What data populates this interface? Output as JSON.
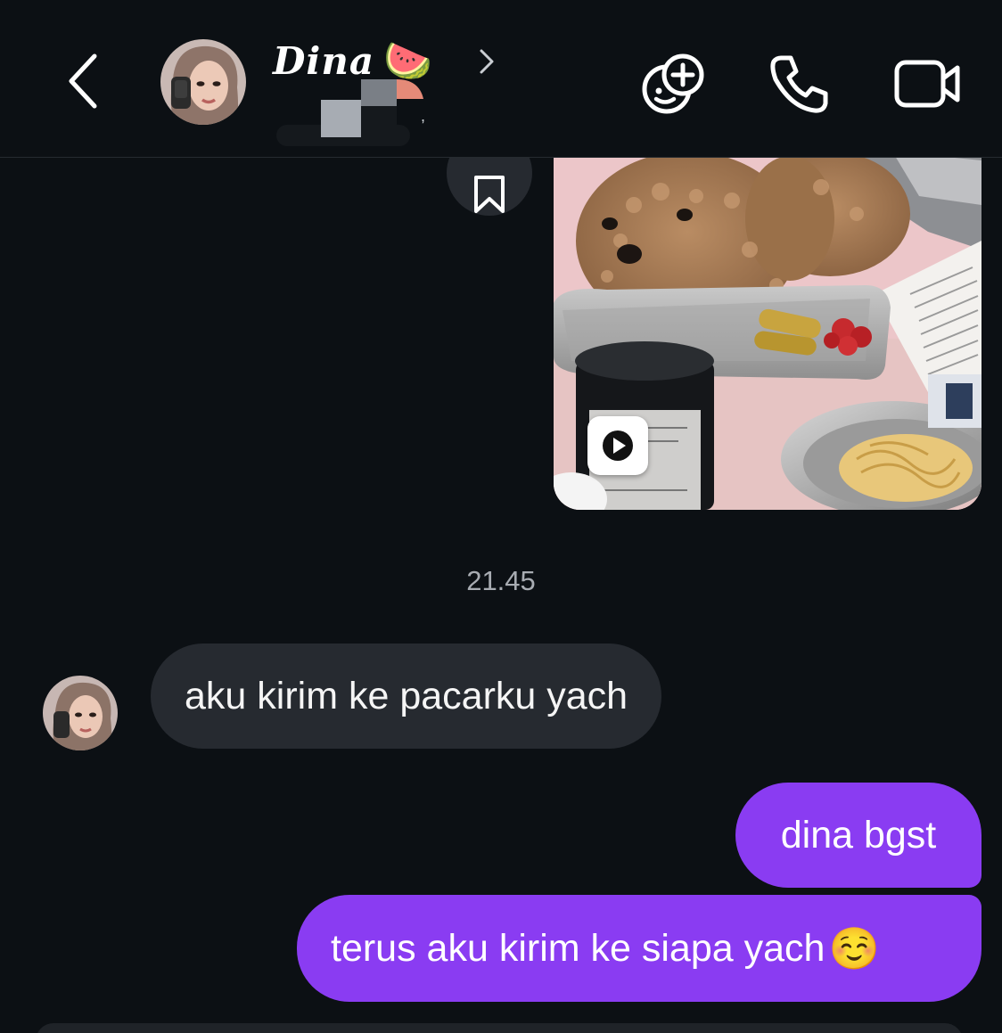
{
  "header": {
    "contact_name": "Dina",
    "name_emoji": "🍉"
  },
  "chat": {
    "timestamp": "21.45",
    "messages": [
      {
        "direction": "incoming",
        "text": "aku kirim ke pacarku yach"
      },
      {
        "direction": "outgoing",
        "text": "dina bgst"
      },
      {
        "direction": "outgoing",
        "text": "terus aku kirim ke siapa yach",
        "emoji": "☺️"
      }
    ]
  },
  "colors": {
    "background": "#0c1014",
    "outgoing_bubble": "#8a3cf2",
    "incoming_bubble": "#262a30",
    "timestamp": "#a8acb2"
  }
}
